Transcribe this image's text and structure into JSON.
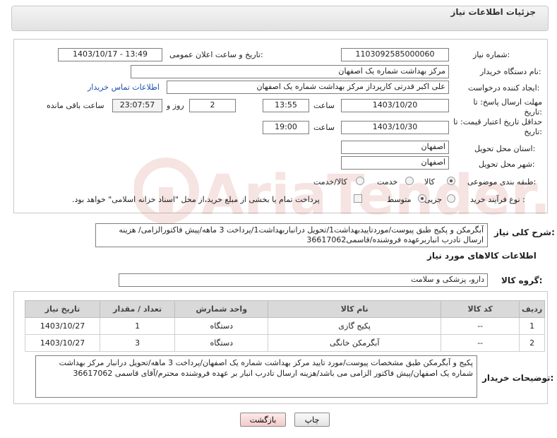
{
  "header": {
    "title": "جزئیات اطلاعات نیاز"
  },
  "form": {
    "need_number": {
      "label": "شماره نیاز:",
      "value": "1103092585000060"
    },
    "announce_datetime": {
      "label": "تاریخ و ساعت اعلان عمومی:",
      "value": "1403/10/17 - 13:49"
    },
    "buyer_org": {
      "label": "نام دستگاه خریدار:",
      "value": "مرکز بهداشت شماره یک اصفهان"
    },
    "requester": {
      "label": "ایجاد کننده درخواست:",
      "value": "علی اکبر قدرتی کارپرداز مرکز بهداشت شماره یک اصفهان",
      "contact_link": "اطلاعات تماس خریدار"
    },
    "reply_deadline": {
      "label": "مهلت ارسال پاسخ: تا تاریخ:",
      "date": "1403/10/20",
      "time_label": "ساعت",
      "time": "13:55",
      "days": "2",
      "days_label": "روز و",
      "remaining": "23:07:57",
      "remaining_label": "ساعت باقی مانده"
    },
    "price_validity": {
      "label": "حداقل تاریخ اعتبار قیمت: تا تاریخ:",
      "date": "1403/10/30",
      "time_label": "ساعت",
      "time": "19:00"
    },
    "province": {
      "label": "استان محل تحویل:",
      "value": "اصفهان"
    },
    "city": {
      "label": "شهر محل تحویل:",
      "value": "اصفهان"
    },
    "category": {
      "label": "طبقه بندی موضوعی:",
      "options": [
        "کالا",
        "خدمت",
        "کالا/خدمت"
      ],
      "selected": "کالا"
    },
    "purchase_type": {
      "label": "نوع فرآیند خرید :",
      "options": [
        "جزیی",
        "متوسط"
      ],
      "selected": "متوسط",
      "payment_note": "پرداخت تمام یا بخشی از مبلغ خرید،از محل \"اسناد خزانه اسلامی\" خواهد بود."
    }
  },
  "summary": {
    "label": "شرح کلی نیاز:",
    "text": "آبگرمکن و پکیج طبق پیوست/موردتاییدبهداشت1/تحویل درانباربهداشت1/پرداخت 3 ماهه/پیش فاکتورالزامی/ هزینه ارسال تادرب انباربرعهده فروشنده/قاسمی36617062"
  },
  "goods": {
    "section_title": "اطلاعات کالاهای مورد نیاز",
    "group_label": "گروه کالا:",
    "group_value": "دارو، پزشکی و سلامت",
    "columns": [
      "ردیف",
      "کد کالا",
      "نام کالا",
      "واحد شمارش",
      "تعداد / مقدار",
      "تاریخ نیاز"
    ],
    "rows": [
      {
        "index": "1",
        "code": "--",
        "name": "پکیج گازی",
        "unit": "دستگاه",
        "qty": "1",
        "date": "1403/10/27"
      },
      {
        "index": "2",
        "code": "--",
        "name": "آبگرمکن خانگی",
        "unit": "دستگاه",
        "qty": "3",
        "date": "1403/10/27"
      }
    ]
  },
  "buyer_notes": {
    "label": "توضیحات خریدار:",
    "text": "پکیج و آبگرمکن طبق مشخصات پیوست/مورد تایید مرکز بهداشت شماره یک اصفهان/پرداخت 3 ماهه/تحویل درانبار مرکز بهداشت شماره یک اصفهان/پیش فاکتور الزامی می باشد/هزینه ارسال تادرب انبار بر عهده فروشنده محترم/آقای قاسمی 36617062"
  },
  "buttons": {
    "print": "چاپ",
    "back": "بازگشت"
  },
  "watermark": {
    "text": "AriaTender.neT"
  },
  "colors": {
    "link": "#1a4fb0",
    "header_bg": "#e9e9e9",
    "table_header": "#d9d9d9",
    "watermark": "#c0392b"
  }
}
